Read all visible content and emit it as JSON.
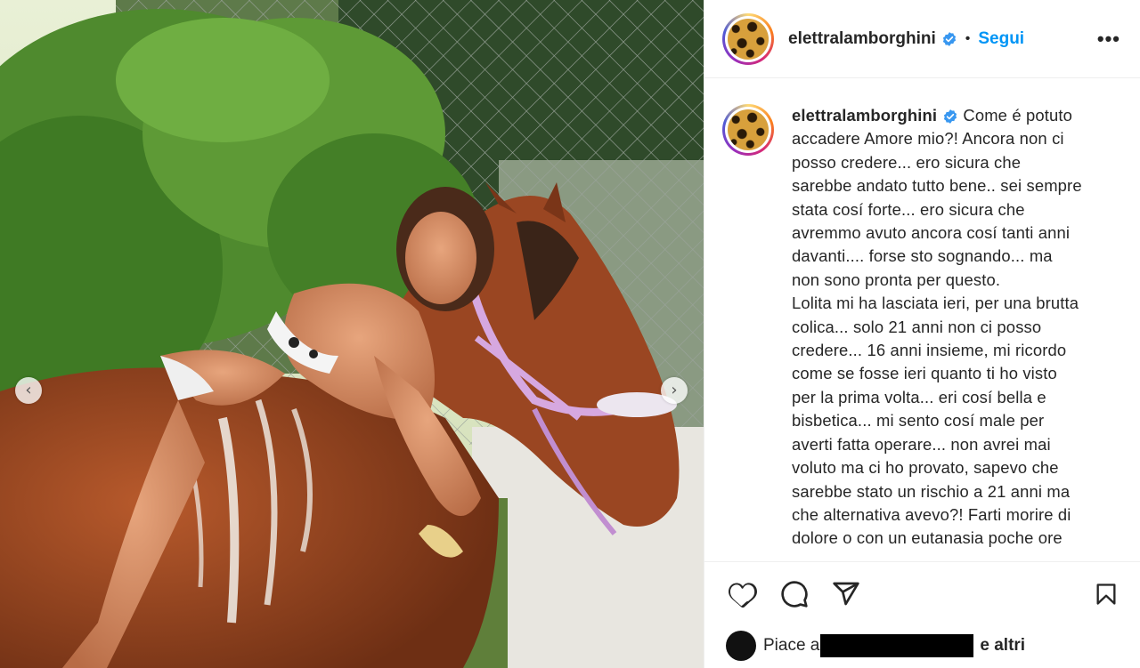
{
  "post": {
    "username": "elettralamborghini",
    "follow_label": "Segui",
    "separator": "•",
    "more_label": "•••",
    "caption_user": "elettralamborghini",
    "caption": " Come é potuto\naccadere Amore mio?! Ancora non ci\nposso credere... ero sicura che\nsarebbe andato tutto bene.. sei sempre\nstata cosí forte... ero sicura che\navremmo avuto ancora cosí tanti anni\ndavanti.... forse sto sognando... ma\nnon sono pronta per questo.\nLolita mi ha lasciata ieri, per una brutta\ncolica... solo 21 anni non ci posso\ncredere... 16 anni insieme, mi ricordo\ncome se fosse ieri quanto ti ho visto\nper la prima volta... eri cosí bella e\nbisbetica... mi sento cosí male per\naverti fatta operare... non avrei mai\nvoluto ma ci ho provato, sapevo che\nsarebbe stato un rischio a 21 anni ma\nche alternativa avevo?! Farti morire di\ndolore o con un eutanasia poche ore",
    "likes_prefix": "Piace a",
    "likes_suffix": "e altri"
  },
  "icons": {
    "verified": "verified-badge-icon",
    "like": "heart-icon",
    "comment": "comment-icon",
    "share": "send-icon",
    "save": "bookmark-icon",
    "prev": "chevron-left-icon",
    "next": "chevron-right-icon"
  },
  "nav": {
    "prev_glyph": "‹",
    "next_glyph": "›"
  },
  "colors": {
    "accent": "#0095f6",
    "text": "#262626",
    "border": "#efefef"
  }
}
